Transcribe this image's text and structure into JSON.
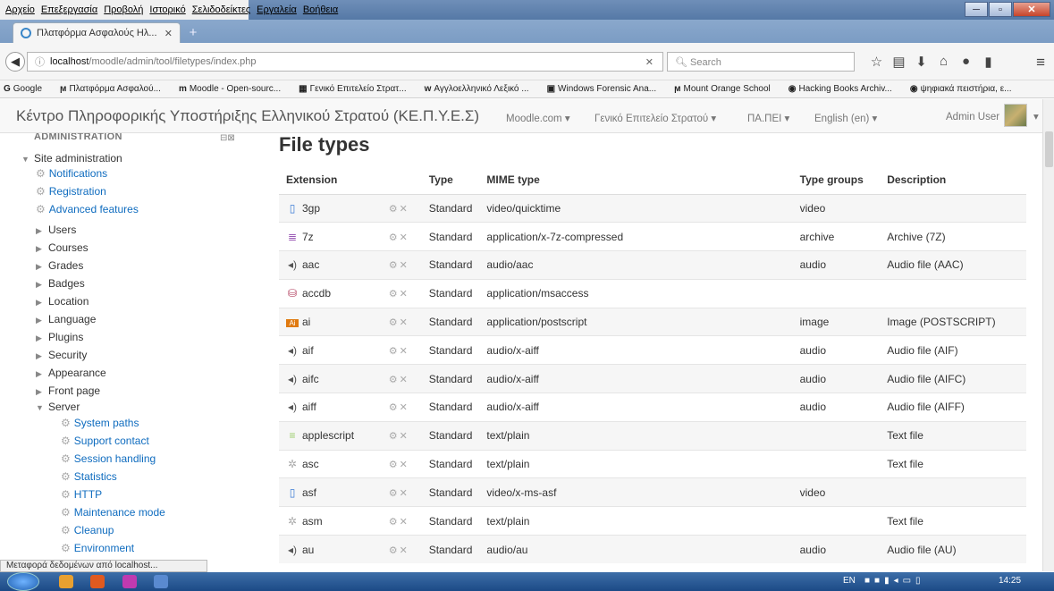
{
  "menubar": {
    "items": [
      "Αρχείο",
      "Επεξεργασία",
      "Προβολή",
      "Ιστορικό",
      "Σελιδοδείκτες",
      "Εργαλεία",
      "Βοήθεια"
    ]
  },
  "browser": {
    "tab_title": "Πλατφόρμα Ασφαλούς Ηλ...",
    "url_host": "localhost",
    "url_path": "/moodle/admin/tool/filetypes/index.php",
    "search_placeholder": "Search"
  },
  "bookmarks": [
    "Google",
    "Πλατφόρμα Ασφαλού...",
    "Moodle - Open-sourc...",
    "Γενικό Επιτελείο Στρατ...",
    "Αγγλοελληνικό Λεξικό ...",
    "Windows Forensic Ana...",
    "Mount Orange School",
    "Hacking Books Archiv...",
    "ψηφιακά πειστήρια, ε..."
  ],
  "header": {
    "site_title": "Κέντρο Πληροφορικής Υποστήριξης Ελληνικού Στρατού (ΚΕ.Π.Υ.Ε.Σ)",
    "nav": [
      "Moodle.com ▾",
      "Γενικό Επιτελείο Στρατού ▾",
      "ΠΑ.ΠΕΙ ▾",
      "English (en) ▾"
    ],
    "user": "Admin User"
  },
  "sidebar": {
    "heading": "ADMINISTRATION",
    "root": "Site administration",
    "links": [
      "Notifications",
      "Registration",
      "Advanced features"
    ],
    "folders": [
      "Users",
      "Courses",
      "Grades",
      "Badges",
      "Location",
      "Language",
      "Plugins",
      "Security",
      "Appearance",
      "Front page"
    ],
    "server": "Server",
    "server_links": [
      "System paths",
      "Support contact",
      "Session handling",
      "Statistics",
      "HTTP",
      "Maintenance mode",
      "Cleanup",
      "Environment"
    ]
  },
  "main": {
    "title": "File types",
    "columns": [
      "Extension",
      "",
      "Type",
      "MIME type",
      "Type groups",
      "Description"
    ],
    "rows": [
      {
        "icon": "video-icon",
        "ext": "3gp",
        "type": "Standard",
        "mime": "video/quicktime",
        "group": "video",
        "desc": ""
      },
      {
        "icon": "archive-icon",
        "ext": "7z",
        "type": "Standard",
        "mime": "application/x-7z-compressed",
        "group": "archive",
        "desc": "Archive (7Z)"
      },
      {
        "icon": "audio-icon",
        "ext": "aac",
        "type": "Standard",
        "mime": "audio/aac",
        "group": "audio",
        "desc": "Audio file (AAC)"
      },
      {
        "icon": "database-icon",
        "ext": "accdb",
        "type": "Standard",
        "mime": "application/msaccess",
        "group": "",
        "desc": ""
      },
      {
        "icon": "illustrator-icon",
        "ext": "ai",
        "type": "Standard",
        "mime": "application/postscript",
        "group": "image",
        "desc": "Image (POSTSCRIPT)"
      },
      {
        "icon": "audio-icon",
        "ext": "aif",
        "type": "Standard",
        "mime": "audio/x-aiff",
        "group": "audio",
        "desc": "Audio file (AIF)"
      },
      {
        "icon": "audio-icon",
        "ext": "aifc",
        "type": "Standard",
        "mime": "audio/x-aiff",
        "group": "audio",
        "desc": "Audio file (AIFC)"
      },
      {
        "icon": "audio-icon",
        "ext": "aiff",
        "type": "Standard",
        "mime": "audio/x-aiff",
        "group": "audio",
        "desc": "Audio file (AIFF)"
      },
      {
        "icon": "text-icon",
        "ext": "applescript",
        "type": "Standard",
        "mime": "text/plain",
        "group": "",
        "desc": "Text file"
      },
      {
        "icon": "source-icon",
        "ext": "asc",
        "type": "Standard",
        "mime": "text/plain",
        "group": "",
        "desc": "Text file"
      },
      {
        "icon": "video-icon",
        "ext": "asf",
        "type": "Standard",
        "mime": "video/x-ms-asf",
        "group": "video",
        "desc": ""
      },
      {
        "icon": "source-icon",
        "ext": "asm",
        "type": "Standard",
        "mime": "text/plain",
        "group": "",
        "desc": "Text file"
      },
      {
        "icon": "audio-icon",
        "ext": "au",
        "type": "Standard",
        "mime": "audio/au",
        "group": "audio",
        "desc": "Audio file (AU)"
      }
    ]
  },
  "status": "Μεταφορά δεδομένων από localhost...",
  "taskbar": {
    "lang": "EN",
    "time": "14:25"
  }
}
